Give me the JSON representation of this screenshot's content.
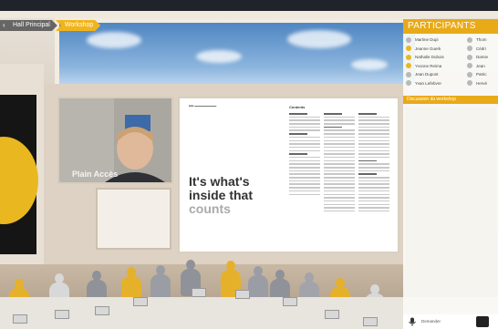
{
  "breadcrumb": {
    "items": [
      {
        "label": "Hall Principal",
        "active": false
      },
      {
        "label": "Workshop",
        "active": true
      }
    ]
  },
  "video": {
    "label": "Plain Accès"
  },
  "slide": {
    "big_line1": "It's what's",
    "big_line2": "inside that",
    "big_line3": "counts",
    "contents_title": "Contents"
  },
  "participants": {
    "title": "PARTICIPANTS",
    "left_column": [
      {
        "name": "Martine Dupi",
        "color": "#b8b8b8"
      },
      {
        "name": "Jeanne Guerk",
        "color": "#e9b820"
      },
      {
        "name": "Nathalie Dubois",
        "color": "#e9b820"
      },
      {
        "name": "Yvonne Reima",
        "color": "#e9b820"
      },
      {
        "name": "Jean Dupont",
        "color": "#b8b8b8"
      },
      {
        "name": "Yvan Lefebvre",
        "color": "#b8b8b8"
      }
    ],
    "right_column": [
      {
        "name": "Thom",
        "color": "#b8b8b8"
      },
      {
        "name": "Cédri",
        "color": "#b8b8b8"
      },
      {
        "name": "Damie",
        "color": "#b8b8b8"
      },
      {
        "name": "Jean",
        "color": "#b8b8b8"
      },
      {
        "name": "Patric",
        "color": "#b8b8b8"
      },
      {
        "name": "Hervé",
        "color": "#b8b8b8"
      }
    ],
    "discussion_label": "Discussion du workshop"
  },
  "bottom": {
    "label": "Demander",
    "mic_icon": "microphone-icon"
  },
  "colors": {
    "accent": "#e9aa18",
    "wall": "#ddd2c3",
    "dark_panel": "#151515"
  }
}
